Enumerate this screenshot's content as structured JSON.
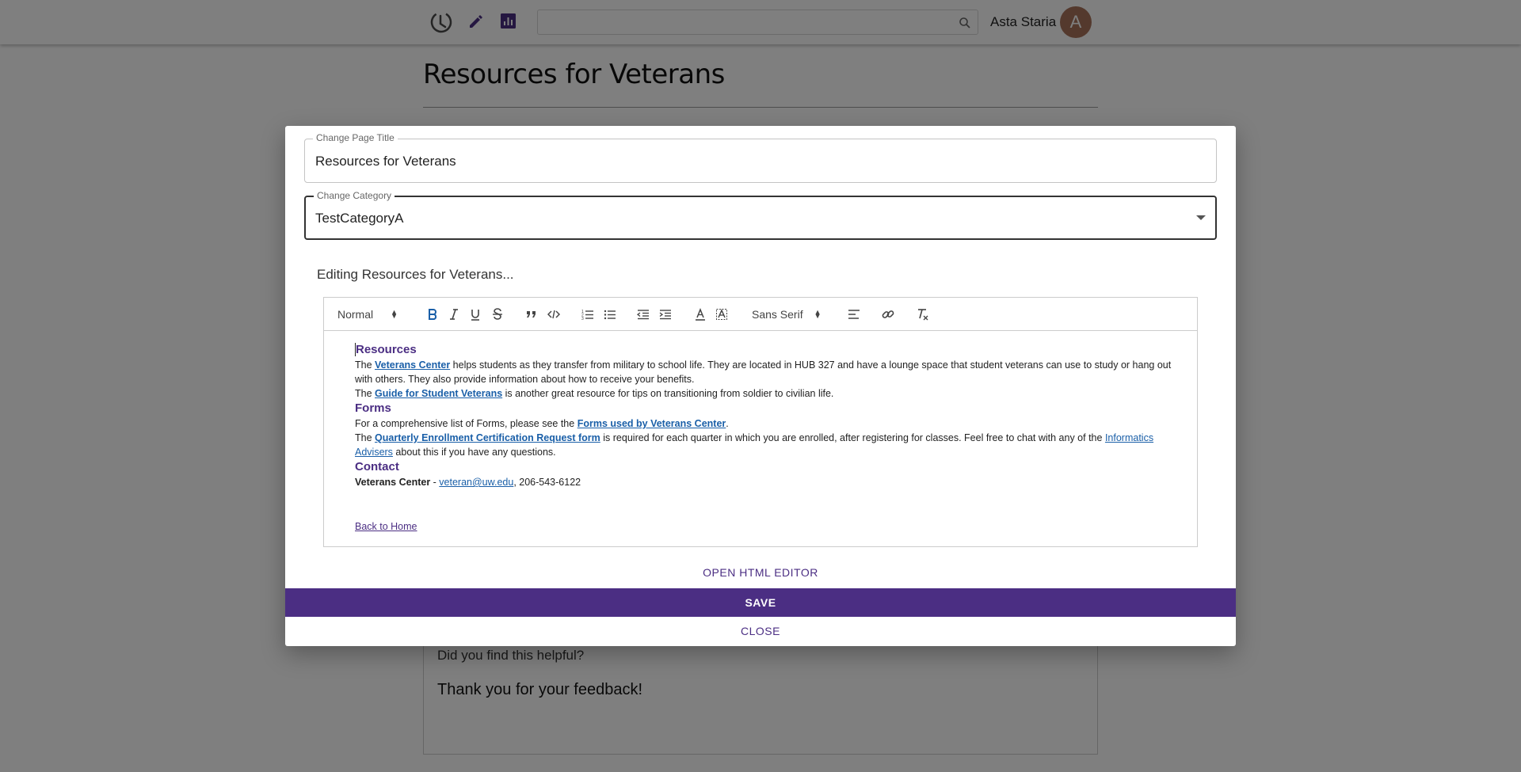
{
  "header": {
    "user_name": "Asta Staria",
    "avatar_initial": "A",
    "search_placeholder": ""
  },
  "page": {
    "title": "Resources for Veterans",
    "feedback_question": "Did you find this helpful?",
    "feedback_thanks": "Thank you for your feedback!"
  },
  "modal": {
    "title_label": "Change Page Title",
    "title_value": "Resources for Veterans",
    "category_label": "Change Category",
    "category_value": "TestCategoryA",
    "editing_label": "Editing Resources for Veterans...",
    "toolbar": {
      "format_select": "Normal",
      "font_select": "Sans Serif"
    },
    "content": {
      "h_resources": "Resources",
      "p1_pre": "The ",
      "p1_link": "Veterans Center",
      "p1_post": " helps students as they transfer from military to school life. They are located in HUB 327 and have a lounge space that student veterans can use to study or hang out with others. They also provide information about how to receive your benefits.",
      "p2_pre": "The ",
      "p2_link": "Guide for Student Veterans",
      "p2_post": " is another great resource for tips on transitioning from soldier to civilian life.",
      "h_forms": "Forms",
      "p3_pre": "For a comprehensive list of Forms, please see the ",
      "p3_link": "Forms used by Veterans Center",
      "p3_post": ".",
      "p4_pre": "The ",
      "p4_link": "Quarterly Enrollment Certification Request form",
      "p4_mid": " is required for each quarter in which you are enrolled, after registering for classes. Feel free to chat with any of the ",
      "p4_link2": "Informatics Advisers",
      "p4_post": " about this if you have any questions.",
      "h_contact": "Contact",
      "contact_name": "Veterans Center",
      "contact_sep": " - ",
      "contact_email": "veteran@uw.edu",
      "contact_phone": ", 206-543-6122",
      "back_link": "Back to Home"
    },
    "open_html_editor": "OPEN HTML EDITOR",
    "save": "SAVE",
    "close": "CLOSE"
  },
  "colors": {
    "brand_purple": "#4b2e83",
    "link_blue": "#1a5fa8"
  }
}
